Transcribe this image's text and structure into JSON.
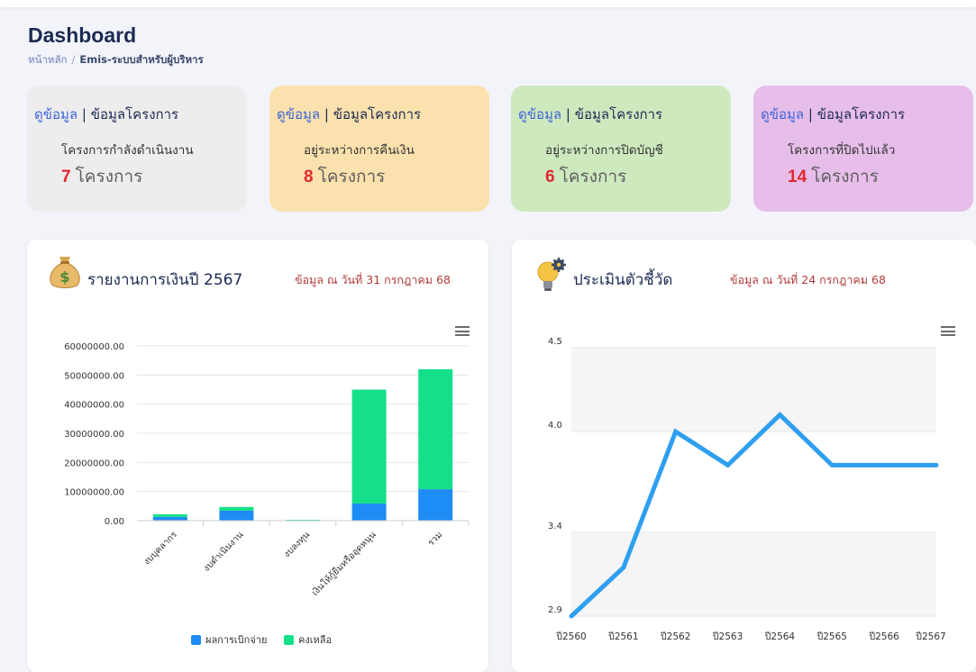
{
  "page": {
    "title": "Dashboard",
    "breadcrumb": {
      "home": "หน้าหลัก",
      "separator": "/",
      "current": "Emis-ระบบสำหรับผู้บริหาร"
    }
  },
  "cards": [
    {
      "link": "ดูข้อมูล",
      "divider": "|",
      "heading": "ข้อมูลโครงการ",
      "subtitle": "โครงการกำลังดำเนินงาน",
      "count": "7",
      "unit": "โครงการ",
      "bg": "#ededed"
    },
    {
      "link": "ดูข้อมูล",
      "divider": "|",
      "heading": "ข้อมูลโครงการ",
      "subtitle": "อยู่ระหว่างการคืนเงิน",
      "count": "8",
      "unit": "โครงการ",
      "bg": "#fbe1ad"
    },
    {
      "link": "ดูข้อมูล",
      "divider": "|",
      "heading": "ข้อมูลโครงการ",
      "subtitle": "อยู่ระหว่างการปิดบัญชี",
      "count": "6",
      "unit": "โครงการ",
      "bg": "#cfe9bf"
    },
    {
      "link": "ดูข้อมูล",
      "divider": "|",
      "heading": "ข้อมูลโครงการ",
      "subtitle": "โครงการที่ปิดไปแล้ว",
      "count": "14",
      "unit": "โครงการ",
      "bg": "#e7bdea"
    }
  ],
  "finance_panel": {
    "title": "รายงานการเงินปี 2567",
    "date": "ข้อมูล ณ วันที่ 31 กรกฎาคม 68",
    "icon": "money-bag-icon"
  },
  "kpi_panel": {
    "title": "ประเมินตัวชี้วัด",
    "date": "ข้อมูล ณ วันที่ 24 กรกฎาคม 68",
    "icon": "lightbulb-gear-icon"
  },
  "colors": {
    "spent": "#1e8cf5",
    "remaining": "#14e08a",
    "line": "#2f9ff0",
    "count_red": "#e0282f"
  },
  "chart_data": [
    {
      "type": "bar",
      "stacked": true,
      "categories": [
        "งบบุคลากร",
        "งบดำเนินงาน",
        "งบลงทุน",
        "เงินให้กู้ยืมหรืออุดหนุน",
        "รวม"
      ],
      "series": [
        {
          "name": "ผลการเบิกจ่าย",
          "values": [
            1300000,
            3400000,
            100000,
            5900000,
            10800000
          ]
        },
        {
          "name": "คงเหลือ",
          "values": [
            900000,
            1300000,
            200000,
            39100000,
            41200000
          ]
        }
      ],
      "yticks": [
        "0.00",
        "10000000.00",
        "20000000.00",
        "30000000.00",
        "40000000.00",
        "50000000.00",
        "60000000.00"
      ],
      "ylim": [
        0,
        60000000
      ],
      "legend": "bottom",
      "grid": true
    },
    {
      "type": "line",
      "categories": [
        "ปี2560",
        "ปี2561",
        "ปี2562",
        "ปี2563",
        "ปี2564",
        "ปี2565",
        "ปี2566",
        "ปี2567"
      ],
      "values": [
        2.9,
        3.19,
        4.0,
        3.8,
        4.1,
        3.8,
        3.8,
        3.8
      ],
      "ytick_values": [
        2.9,
        3.4,
        4.0,
        4.5
      ],
      "yticks": [
        "2.9",
        "3.4",
        "4.0",
        "4.5"
      ],
      "ylim": [
        2.9,
        4.5
      ],
      "grid": true
    }
  ]
}
